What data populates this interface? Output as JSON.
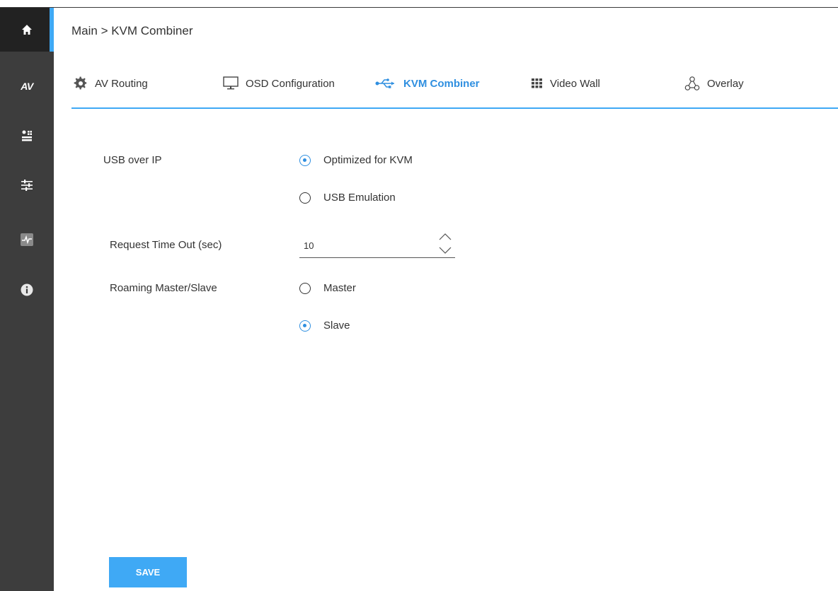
{
  "breadcrumb": "Main > KVM Combiner",
  "sidebar": {
    "items": [
      {
        "icon": "home-icon"
      },
      {
        "icon": "av-icon",
        "label": "AV"
      },
      {
        "icon": "device-settings-icon"
      },
      {
        "icon": "sliders-icon"
      },
      {
        "icon": "diagnostics-icon"
      },
      {
        "icon": "info-icon"
      }
    ],
    "accent": "#3fa9f5"
  },
  "tabs": [
    {
      "label": "AV Routing",
      "icon": "gear-icon"
    },
    {
      "label": "OSD Configuration",
      "icon": "monitor-icon"
    },
    {
      "label": "KVM Combiner",
      "icon": "usb-icon",
      "active": true
    },
    {
      "label": "Video Wall",
      "icon": "grid-icon"
    },
    {
      "label": "Overlay",
      "icon": "overlay-icon"
    }
  ],
  "form": {
    "usb_over_ip": {
      "label": "USB over IP",
      "options": [
        "Optimized for KVM",
        "USB Emulation"
      ],
      "selected": "Optimized for KVM"
    },
    "request_timeout": {
      "label": "Request Time Out (sec)",
      "value": "10"
    },
    "roaming": {
      "label": "Roaming Master/Slave",
      "options": [
        "Master",
        "Slave"
      ],
      "selected": "Slave"
    }
  },
  "save_label": "SAVE",
  "colors": {
    "accent": "#3fa9f5",
    "active_tab": "#2f8fe0",
    "sidebar": "#3d3d3d"
  }
}
